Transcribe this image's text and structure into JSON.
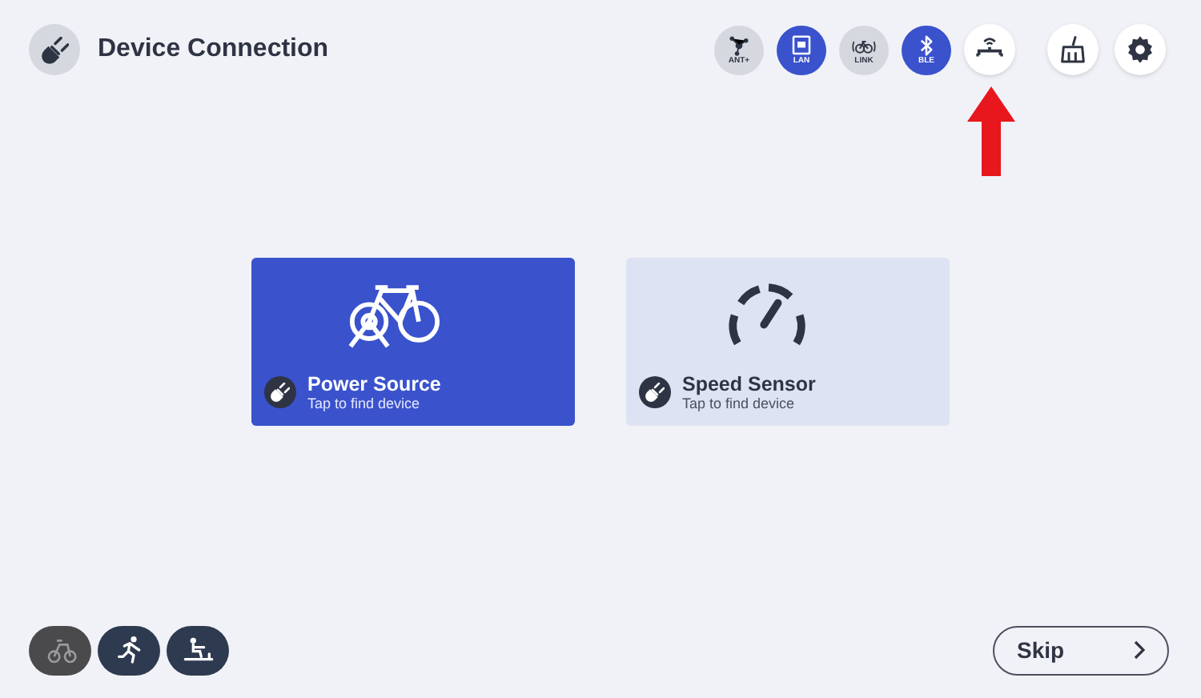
{
  "header": {
    "title": "Device Connection"
  },
  "connections": [
    {
      "kind": "ant",
      "label": "ANT+",
      "on": false
    },
    {
      "kind": "lan",
      "label": "LAN",
      "on": true
    },
    {
      "kind": "link",
      "label": "LINK",
      "on": false
    },
    {
      "kind": "ble",
      "label": "BLE",
      "on": true
    }
  ],
  "tools": [
    {
      "kind": "bridge"
    },
    {
      "kind": "clean"
    },
    {
      "kind": "settings"
    }
  ],
  "cards": [
    {
      "kind": "bike",
      "title": "Power Source",
      "subtitle": "Tap to find device",
      "selected": true
    },
    {
      "kind": "speed",
      "title": "Speed Sensor",
      "subtitle": "Tap to find device",
      "selected": false
    }
  ],
  "sports": [
    {
      "kind": "bike",
      "selected": true
    },
    {
      "kind": "run",
      "selected": false
    },
    {
      "kind": "row",
      "selected": false
    }
  ],
  "skip_button": {
    "label": "Skip"
  }
}
